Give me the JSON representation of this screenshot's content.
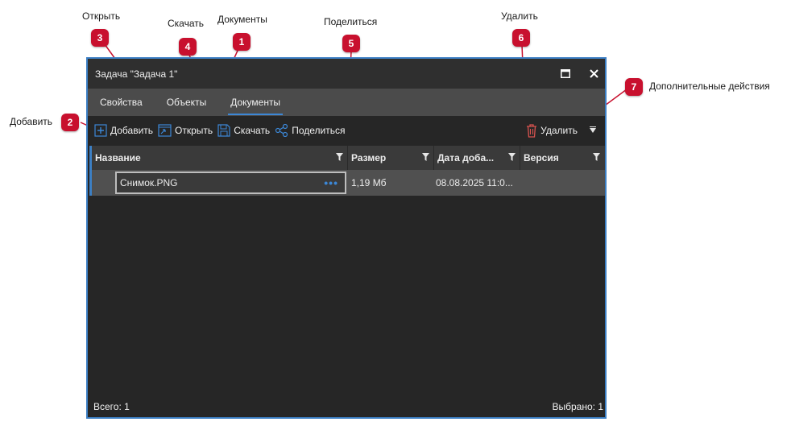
{
  "annotations": [
    {
      "num": "1",
      "label": "Документы"
    },
    {
      "num": "2",
      "label": "Добавить"
    },
    {
      "num": "3",
      "label": "Открыть"
    },
    {
      "num": "4",
      "label": "Скачать"
    },
    {
      "num": "5",
      "label": "Поделиться"
    },
    {
      "num": "6",
      "label": "Удалить"
    },
    {
      "num": "7",
      "label": "Дополнительные действия"
    }
  ],
  "window": {
    "title": "Задача \"Задача  1\"",
    "maximize_icon": "maximize-icon",
    "close_icon": "close-icon"
  },
  "tabs": [
    {
      "label": "Свойства",
      "active": false
    },
    {
      "label": "Объекты",
      "active": false
    },
    {
      "label": "Документы",
      "active": true
    }
  ],
  "toolbar": {
    "add_label": "Добавить",
    "open_label": "Открыть",
    "download_label": "Скачать",
    "share_label": "Поделиться",
    "delete_label": "Удалить",
    "more_icon": "triangle-down-icon"
  },
  "grid": {
    "columns": [
      "Название",
      "Размер",
      "Дата доба...",
      "Версия"
    ],
    "rows": [
      {
        "name": "Снимок.PNG",
        "size": "1,19 Мб",
        "date": "08.08.2025 11:0...",
        "version": ""
      }
    ]
  },
  "footer": {
    "total": "Всего: 1",
    "selected": "Выбрано: 1"
  },
  "colors": {
    "accent": "#3c7fc4",
    "badge": "#c8102e",
    "delete": "#d9534f",
    "window_bg": "#262626"
  }
}
